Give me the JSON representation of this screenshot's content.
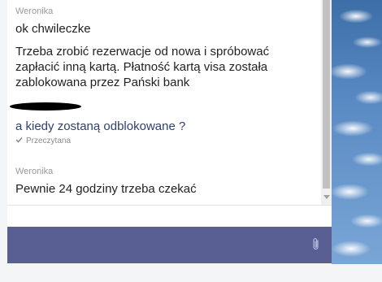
{
  "messages": [
    {
      "sender": "Weronika",
      "lines": [
        "ok chwileczke"
      ]
    },
    {
      "lines": [
        "Trzeba zrobić rezerwacje od nowa i spróbować",
        "zapłacić inną kartą. Płatność kartą visa została",
        "zablokowana przez Pański bank"
      ]
    },
    {
      "own_text": "a kiedy zostaną odblokowane ?",
      "status": "Przeczytana"
    },
    {
      "sender": "Weronika",
      "lines": [
        "Pewnie 24 godziny trzeba czekać"
      ]
    }
  ],
  "colors": {
    "composer": "#5a5f93",
    "own_message": "#2f3f6e"
  },
  "icons": {
    "read_check": "check-icon",
    "attach": "paperclip-icon"
  }
}
